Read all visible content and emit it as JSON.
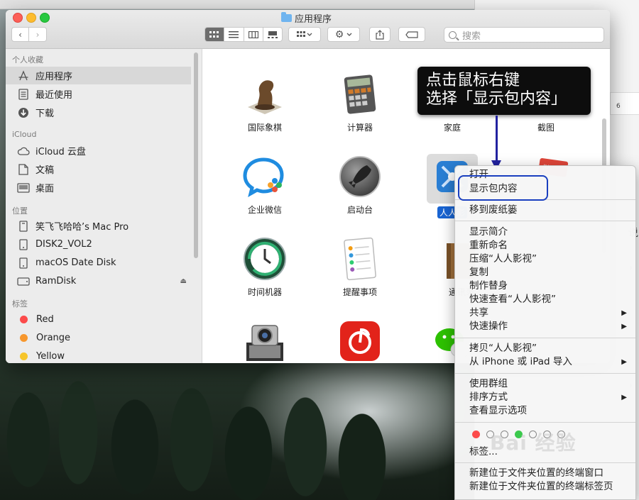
{
  "window": {
    "title": "应用程序"
  },
  "toolbar": {
    "back": "‹",
    "forward": "›",
    "search_placeholder": "搜索"
  },
  "sidebar": {
    "sections": [
      {
        "header": "个人收藏",
        "items": [
          {
            "label": "应用程序",
            "icon": "applications-icon",
            "selected": true
          },
          {
            "label": "最近使用",
            "icon": "recents-icon"
          },
          {
            "label": "下载",
            "icon": "downloads-icon"
          }
        ]
      },
      {
        "header": "iCloud",
        "items": [
          {
            "label": "iCloud 云盘",
            "icon": "cloud-icon"
          },
          {
            "label": "文稿",
            "icon": "documents-icon"
          },
          {
            "label": "桌面",
            "icon": "desktop-icon"
          }
        ]
      },
      {
        "header": "位置",
        "items": [
          {
            "label": "笑飞飞哈哈’s Mac Pro",
            "icon": "computer-icon"
          },
          {
            "label": "DISK2_VOL2",
            "icon": "disk-icon"
          },
          {
            "label": "macOS Date Disk",
            "icon": "disk-icon"
          },
          {
            "label": "RamDisk",
            "icon": "disk-icon",
            "eject": true
          }
        ]
      },
      {
        "header": "标签",
        "items": [
          {
            "label": "Red",
            "color": "#fc4b4b"
          },
          {
            "label": "Orange",
            "color": "#f7972d"
          },
          {
            "label": "Yellow",
            "color": "#f6c52b"
          }
        ]
      }
    ]
  },
  "apps": [
    {
      "name": "国际象棋",
      "icon": "chess-icon"
    },
    {
      "name": "计算器",
      "icon": "calculator-icon"
    },
    {
      "name": "家庭",
      "icon": "home-icon"
    },
    {
      "name": "截图",
      "icon": "screenshot-icon"
    },
    {
      "name": "企业微信",
      "icon": "wecom-icon"
    },
    {
      "name": "启动台",
      "icon": "launchpad-icon"
    },
    {
      "name": "人人影",
      "icon": "renren-icon",
      "selected": true
    },
    {
      "name": "时间机器",
      "icon": "time-machine-icon"
    },
    {
      "name": "提醒事项",
      "icon": "reminders-icon"
    },
    {
      "name": "通讯录",
      "icon": "contacts-icon"
    },
    {
      "name": "",
      "icon": "image-capture-icon"
    },
    {
      "name": "",
      "icon": "netease-music-icon"
    },
    {
      "name": "",
      "icon": "wechat-icon"
    }
  ],
  "callout": {
    "line1": "点击鼠标右键",
    "line2": "选择「显示包内容」"
  },
  "context_menu": {
    "items": [
      {
        "label": "打开"
      },
      {
        "label": "显示包内容",
        "highlighted": true
      },
      {
        "label": "移到废纸篓"
      },
      {
        "label": "显示简介"
      },
      {
        "label": "重新命名"
      },
      {
        "label": "压缩“人人影视”"
      },
      {
        "label": "复制"
      },
      {
        "label": "制作替身"
      },
      {
        "label": "快速查看“人人影视”"
      },
      {
        "label": "共享",
        "submenu": true
      },
      {
        "label": "快速操作",
        "submenu": true
      },
      {
        "label": "拷贝“人人影视”"
      },
      {
        "label": "从 iPhone 或 iPad 导入",
        "submenu": true
      },
      {
        "label": "使用群组"
      },
      {
        "label": "排序方式",
        "submenu": true
      },
      {
        "label": "查看显示选项"
      },
      {
        "label": "标签..."
      },
      {
        "label": "新建位于文件夹位置的终端窗口"
      },
      {
        "label": "新建位于文件夹位置的终端标签页"
      }
    ],
    "tag_colors": [
      "#fc4b4b",
      "",
      "",
      "#3bc94d",
      "",
      "",
      ""
    ]
  },
  "watermark": "Bai 经验"
}
